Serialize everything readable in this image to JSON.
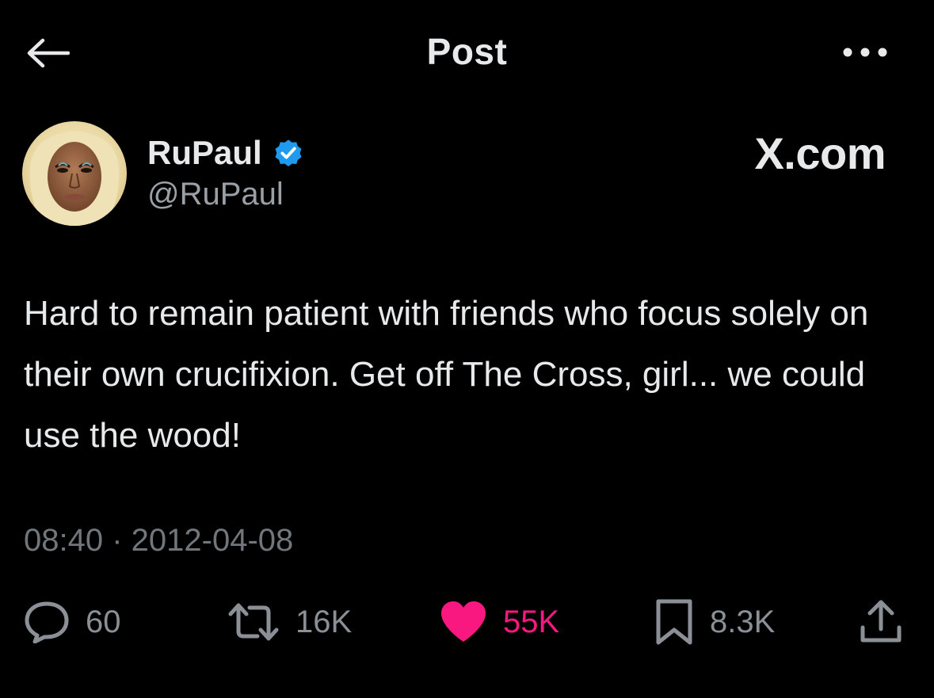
{
  "header": {
    "title": "Post",
    "back_icon": "arrow-left-icon",
    "more_icon": "ellipsis-icon"
  },
  "author": {
    "display_name": "RuPaul",
    "handle": "@RuPaul",
    "verified": true,
    "verified_color": "#1d9bf0",
    "avatar_icon": "avatar"
  },
  "source_brand": "X.com",
  "tweet": {
    "text": "Hard to remain patient with friends who focus solely on their own crucifixion. Get off The Cross, girl... we could use the wood!",
    "timestamp": "08:40 · 2012-04-08"
  },
  "actions": {
    "replies": {
      "icon": "reply-icon",
      "count": "60"
    },
    "reposts": {
      "icon": "repost-icon",
      "count": "16K"
    },
    "likes": {
      "icon": "heart-icon",
      "count": "55K",
      "liked": true,
      "color": "#f91880"
    },
    "bookmarks": {
      "icon": "bookmark-icon",
      "count": "8.3K"
    },
    "share": {
      "icon": "share-icon"
    }
  },
  "colors": {
    "background": "#000000",
    "text_primary": "#e7e9ea",
    "text_secondary": "#71767b",
    "accent": "#1d9bf0",
    "like": "#f91880"
  }
}
